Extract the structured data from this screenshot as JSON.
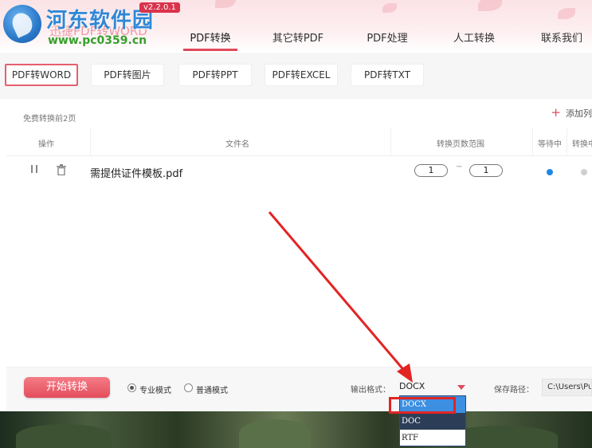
{
  "header": {
    "brand_cn": "河东软件园",
    "brand_sub": "迅捷PDF转WORD",
    "brand_url": "www.pc0359.cn",
    "version": "v2.2.0.1",
    "nav": [
      "PDF转换",
      "其它转PDF",
      "PDF处理",
      "人工转换",
      "联系我们"
    ]
  },
  "subtabs": [
    "PDF转WORD",
    "PDF转图片",
    "PDF转PPT",
    "PDF转EXCEL",
    "PDF转TXT"
  ],
  "panel": {
    "free_note": "免费转换前2页",
    "add_file": "添加列",
    "columns": [
      "操作",
      "文件名",
      "转换页数范围",
      "等待中",
      "转换中"
    ],
    "rows": [
      {
        "name": "需提供证件模板.pdf",
        "page_from": "1",
        "tilde": "~",
        "page_to": "1"
      }
    ]
  },
  "bottom": {
    "start_label": "开始转换",
    "mode_pro": "专业模式",
    "mode_normal": "普通模式",
    "format_label": "输出格式：",
    "format_value": "DOCX",
    "save_label": "保存路径：",
    "save_path": "C:\\Users\\Pub"
  },
  "dropdown": {
    "options": [
      "DOCX",
      "DOC",
      "RTF"
    ]
  },
  "icons": {
    "pause": "pause-icon",
    "delete": "trash-icon",
    "add": "plus-icon",
    "caret": "caret-down-icon"
  },
  "colors": {
    "accent": "#e0485c",
    "waiting_dot": "#1e88e5",
    "converting_dot": "#cfcfcf",
    "dropdown_selected": "#3d8fe2"
  }
}
